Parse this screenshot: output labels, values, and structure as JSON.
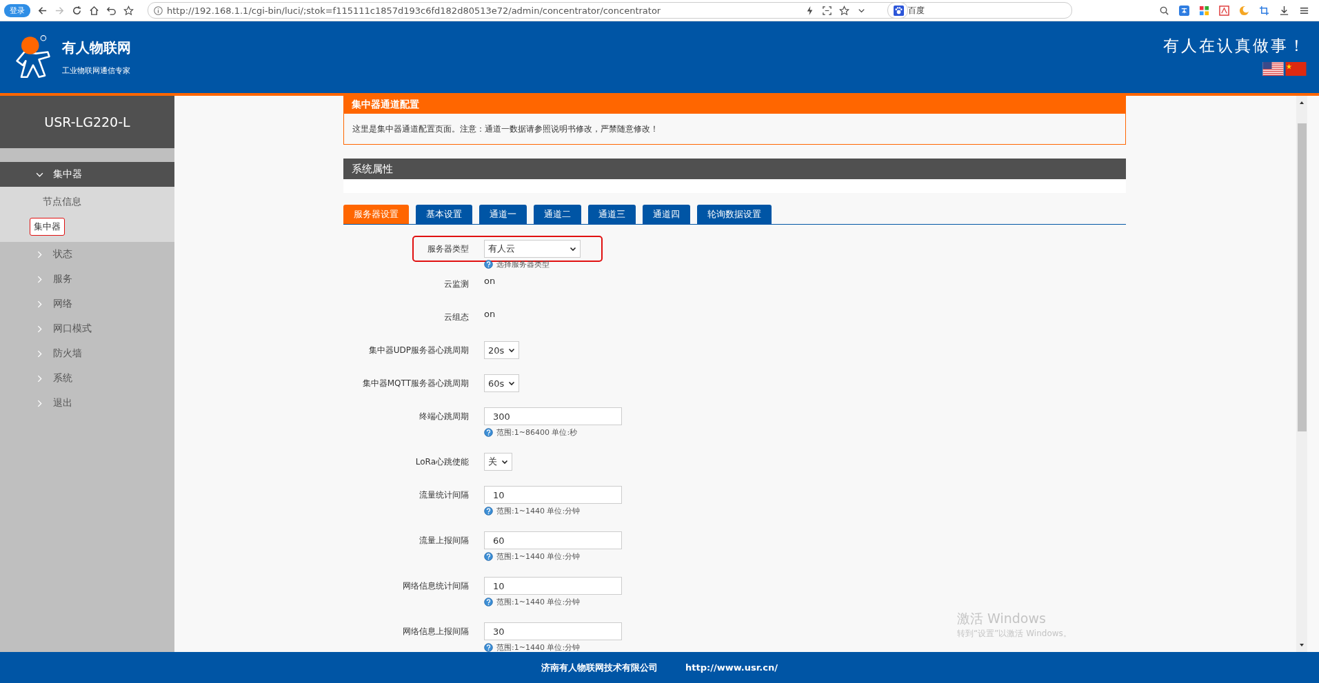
{
  "browser": {
    "login_button": "登录",
    "url": "http://192.168.1.1/cgi-bin/luci/;stok=f115111c1857d193c6fd182d80513e72/admin/concentrator/concentrator",
    "search_engine": "百度"
  },
  "header": {
    "brand": "有人物联网",
    "tagline": "工业物联网通信专家",
    "slogan": "有人在认真做事！"
  },
  "sidebar": {
    "device": "USR-LG220-L",
    "items": [
      {
        "label": "集中器",
        "expanded": true,
        "children": [
          {
            "label": "节点信息",
            "selected": false,
            "highlighted": false
          },
          {
            "label": "集中器",
            "selected": true,
            "highlighted": true
          }
        ]
      },
      {
        "label": "状态",
        "expanded": false
      },
      {
        "label": "服务",
        "expanded": false
      },
      {
        "label": "网络",
        "expanded": false
      },
      {
        "label": "网口模式",
        "expanded": false
      },
      {
        "label": "防火墙",
        "expanded": false
      },
      {
        "label": "系统",
        "expanded": false
      },
      {
        "label": "退出",
        "expanded": false
      }
    ]
  },
  "notice": {
    "title": "集中器通道配置",
    "text": "这里是集中器通道配置页面。注意：通道一数据请参照说明书修改，严禁随意修改！"
  },
  "section": {
    "title": "系统属性"
  },
  "tabs": [
    {
      "label": "服务器设置",
      "selected": true
    },
    {
      "label": "基本设置",
      "selected": false
    },
    {
      "label": "通道一",
      "selected": false
    },
    {
      "label": "通道二",
      "selected": false
    },
    {
      "label": "通道三",
      "selected": false
    },
    {
      "label": "通道四",
      "selected": false
    },
    {
      "label": "轮询数据设置",
      "selected": false
    }
  ],
  "fields": [
    {
      "kind": "select",
      "label": "服务器类型",
      "value": "有人云",
      "help": "选择服务器类型",
      "highlighted": true
    },
    {
      "kind": "text",
      "label": "云监测",
      "value": "on"
    },
    {
      "kind": "text",
      "label": "云组态",
      "value": "on"
    },
    {
      "kind": "select",
      "label": "集中器UDP服务器心跳周期",
      "value": "20s"
    },
    {
      "kind": "select",
      "label": "集中器MQTT服务器心跳周期",
      "value": "60s"
    },
    {
      "kind": "input",
      "label": "终端心跳周期",
      "value": "300",
      "help": "范围:1~86400 单位:秒"
    },
    {
      "kind": "select",
      "label": "LoRa心跳使能",
      "value": "关"
    },
    {
      "kind": "input",
      "label": "流量统计间隔",
      "value": "10",
      "help": "范围:1~1440 单位:分钟"
    },
    {
      "kind": "input",
      "label": "流量上报间隔",
      "value": "60",
      "help": "范围:1~1440 单位:分钟"
    },
    {
      "kind": "input",
      "label": "网络信息统计间隔",
      "value": "10",
      "help": "范围:1~1440 单位:分钟"
    },
    {
      "kind": "input",
      "label": "网络信息上报间隔",
      "value": "30",
      "help": "范围:1~1440 单位:分钟"
    }
  ],
  "footer": {
    "company": "济南有人物联网技术有限公司",
    "url": "http://www.usr.cn/"
  },
  "os_notice": {
    "title": "激活 Windows",
    "text": "转到“设置”以激活 Windows。"
  }
}
